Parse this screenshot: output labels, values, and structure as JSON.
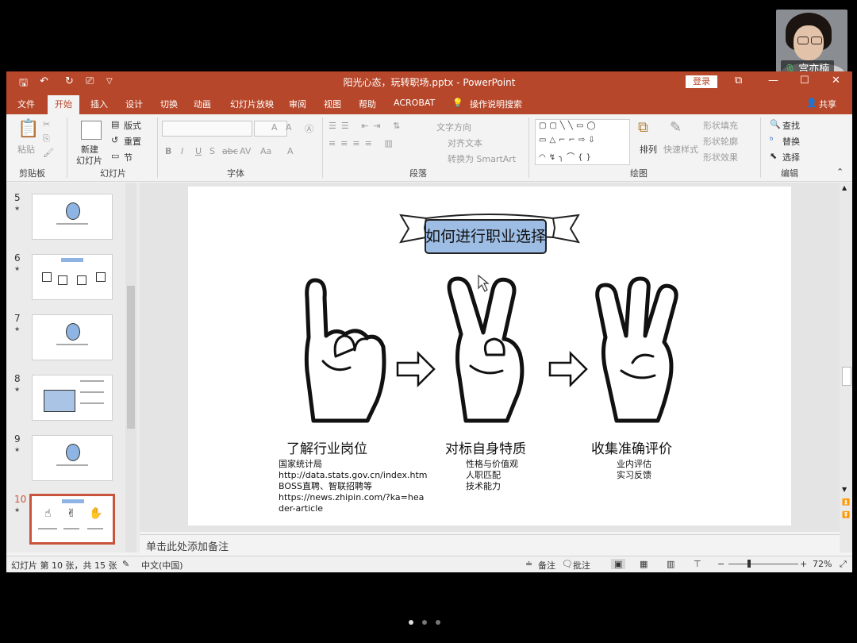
{
  "video": {
    "participant_name": "宫亦楠"
  },
  "window": {
    "title": "阳光心态，玩转职场.pptx - PowerPoint",
    "login_label": "登录",
    "share_label": "共享"
  },
  "tabs": [
    "文件",
    "开始",
    "插入",
    "设计",
    "切换",
    "动画",
    "幻灯片放映",
    "审阅",
    "视图",
    "帮助",
    "ACROBAT"
  ],
  "tell_me": "操作说明搜索",
  "ribbon": {
    "groups": [
      "剪贴板",
      "幻灯片",
      "字体",
      "段落",
      "绘图",
      "编辑"
    ],
    "paste": "粘贴",
    "new_slide_1": "新建",
    "new_slide_2": "幻灯片",
    "layout": "版式",
    "reset": "重置",
    "section": "节",
    "font_size_up": "A",
    "font_size_down": "A",
    "bold": "B",
    "italic": "I",
    "underline": "U",
    "shadow": "S",
    "strike": "abc",
    "spacing": "AV",
    "case": "Aa",
    "font_color": "A",
    "text_direction": "文字方向",
    "align_text": "对齐文本",
    "smartart": "转换为 SmartArt",
    "arrange": "排列",
    "quick_styles": "快速样式",
    "shape_fill": "形状填充",
    "shape_outline": "形状轮廓",
    "shape_effects": "形状效果",
    "find": "查找",
    "replace": "替换",
    "select": "选择"
  },
  "thumbnails": [
    {
      "num": "5"
    },
    {
      "num": "6"
    },
    {
      "num": "7"
    },
    {
      "num": "8"
    },
    {
      "num": "9"
    },
    {
      "num": "10"
    }
  ],
  "slide": {
    "banner_title": "如何进行职业选择",
    "columns": [
      {
        "title": "了解行业岗位",
        "lines": "国家统计局\nhttp://data.stats.gov.cn/index.htm\nBOSS直聘、智联招聘等\nhttps://news.zhipin.com/?ka=hea\nder-article"
      },
      {
        "title": "对标自身特质",
        "lines": "性格与价值观\n人职匹配\n技术能力"
      },
      {
        "title": "收集准确评价",
        "lines": "业内评估\n实习反馈"
      }
    ]
  },
  "notes_placeholder": "单击此处添加备注",
  "status": {
    "slide_info": "幻灯片 第 10 张，共 15 张",
    "language": "中文(中国)",
    "notes": "备注",
    "comments": "批注",
    "zoom": "72%"
  }
}
